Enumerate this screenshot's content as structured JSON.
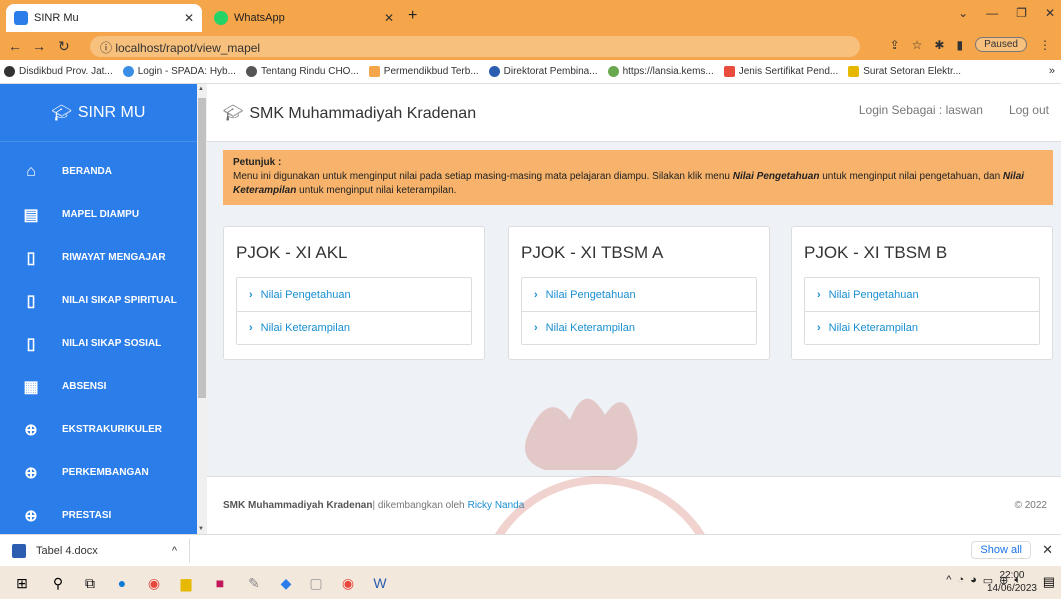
{
  "browser": {
    "tabs": [
      {
        "label": "SINR Mu",
        "active": true
      },
      {
        "label": "WhatsApp",
        "active": false
      }
    ],
    "url": "localhost/rapot/view_mapel",
    "paused_label": "Paused",
    "bookmarks": [
      "Disdikbud Prov. Jat...",
      "Login - SPADA: Hyb...",
      "Tentang Rindu CHO...",
      "Permendikbud Terb...",
      "Direktorat Pembina...",
      "https://lansia.kems...",
      "Jenis Sertifikat Pend...",
      "Surat Setoran Elektr..."
    ]
  },
  "sidebar": {
    "brand": "SINR MU",
    "items": [
      {
        "label": "BERANDA",
        "icon": "home-icon"
      },
      {
        "label": "MAPEL DIAMPU",
        "icon": "clipboard-icon"
      },
      {
        "label": "RIWAYAT MENGAJAR",
        "icon": "document-icon"
      },
      {
        "label": "NILAI SIKAP SPIRITUAL",
        "icon": "document-icon"
      },
      {
        "label": "NILAI SIKAP SOSIAL",
        "icon": "document-icon"
      },
      {
        "label": "ABSENSI",
        "icon": "calendar-icon"
      },
      {
        "label": "EKSTRAKURIKULER",
        "icon": "ball-icon"
      },
      {
        "label": "PERKEMBANGAN",
        "icon": "ball-icon"
      },
      {
        "label": "PRESTASI",
        "icon": "ball-icon"
      }
    ]
  },
  "header": {
    "title": "SMK Muhammadiyah Kradenan",
    "login_as": "Login Sebagai : laswan",
    "logout": "Log out"
  },
  "alert": {
    "heading": "Petunjuk :",
    "text_1": "Menu ini digunakan untuk menginput nilai pada setiap masing-masing mata pelajaran diampu. Silakan klik menu ",
    "em_1": "Nilai Pengetahuan",
    "text_2": " untuk menginput nilai pengetahuan, dan ",
    "em_2": "Nilai Keterampilan",
    "text_3": " untuk menginput nilai keterampilan."
  },
  "cards": [
    {
      "title": "PJOK - XI AKL",
      "link_1": "Nilai Pengetahuan",
      "link_2": "Nilai Keterampilan"
    },
    {
      "title": "PJOK - XI TBSM A",
      "link_1": "Nilai Pengetahuan",
      "link_2": "Nilai Keterampilan"
    },
    {
      "title": "PJOK - XI TBSM B",
      "link_1": "Nilai Pengetahuan",
      "link_2": "Nilai Keterampilan"
    }
  ],
  "footer": {
    "school": "SMK Muhammadiyah Kradenan",
    "developed_by": " | dikembangkan oleh",
    "developer": "Ricky Nanda",
    "copyright": "© 2022"
  },
  "downloads": {
    "file": "Tabel 4.docx",
    "show_all": "Show all"
  },
  "taskbar": {
    "time": "22:00",
    "date": "14/06/2023"
  },
  "colors": {
    "sidebar": "#2b7de9",
    "chrome": "#f5a54a",
    "alert": "#f7b36b",
    "link": "#1a8fd1"
  }
}
